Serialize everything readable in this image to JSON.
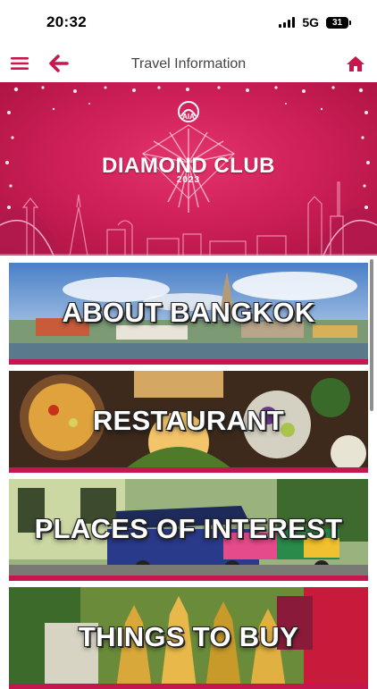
{
  "status_bar": {
    "time": "20:32",
    "network": "5G",
    "battery": "31"
  },
  "nav": {
    "title": "Travel Information",
    "menu_icon": "hamburger-menu-icon",
    "back_icon": "back-arrow-icon",
    "home_icon": "home-icon",
    "accent_color": "#c8174f"
  },
  "banner": {
    "logo_text": "AIA",
    "title": "DIAMOND CLUB",
    "year": "2023",
    "background_color": "#d0205a"
  },
  "cards": [
    {
      "label": "ABOUT BANGKOK",
      "image": "bangkok-skyline-photo"
    },
    {
      "label": "RESTAURANT",
      "image": "thai-food-photo"
    },
    {
      "label": "PLACES OF INTEREST",
      "image": "tuk-tuk-street-photo"
    },
    {
      "label": "THINGS TO BUY",
      "image": "souvenir-market-photo"
    }
  ]
}
